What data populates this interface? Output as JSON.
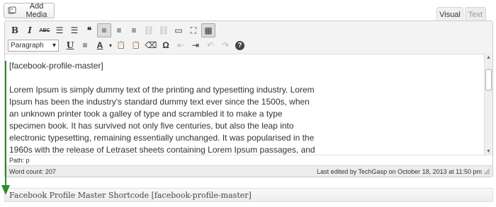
{
  "media": {
    "add_media_label": "Add Media",
    "icon": "media-icon"
  },
  "tabs": {
    "visual": "Visual",
    "text": "Text"
  },
  "toolbar": {
    "row1": [
      {
        "name": "bold-button",
        "glyph": "B"
      },
      {
        "name": "italic-button",
        "glyph": "I"
      },
      {
        "name": "strikethrough-button",
        "glyph": "ABC"
      },
      {
        "name": "bullet-list-button",
        "glyph": "☰"
      },
      {
        "name": "numbered-list-button",
        "glyph": "☰"
      },
      {
        "name": "blockquote-button",
        "glyph": "❝"
      },
      {
        "name": "align-left-button",
        "glyph": "≡"
      },
      {
        "name": "align-center-button",
        "glyph": "≡"
      },
      {
        "name": "align-right-button",
        "glyph": "≡"
      },
      {
        "name": "insert-link-button",
        "glyph": "⛓"
      },
      {
        "name": "remove-link-button",
        "glyph": "⛓"
      },
      {
        "name": "insert-more-button",
        "glyph": "▭"
      },
      {
        "name": "fullscreen-button",
        "glyph": "⛶"
      },
      {
        "name": "kitchen-sink-button",
        "glyph": "▦"
      }
    ],
    "format_select": "Paragraph",
    "row2": [
      {
        "name": "underline-button",
        "glyph": "U"
      },
      {
        "name": "justify-button",
        "glyph": "≡"
      },
      {
        "name": "text-color-button",
        "glyph": "A"
      },
      {
        "name": "paste-text-button",
        "glyph": "📋"
      },
      {
        "name": "paste-word-button",
        "glyph": "📋"
      },
      {
        "name": "clear-formatting-button",
        "glyph": "⌫"
      },
      {
        "name": "special-character-button",
        "glyph": "Ω"
      },
      {
        "name": "outdent-button",
        "glyph": "⇤"
      },
      {
        "name": "indent-button",
        "glyph": "⇥"
      },
      {
        "name": "undo-button",
        "glyph": "↶"
      },
      {
        "name": "redo-button",
        "glyph": "↷"
      },
      {
        "name": "help-button",
        "glyph": "?"
      }
    ]
  },
  "content": {
    "shortcode_line": "[facebook-profile-master]",
    "lorem": "Lorem Ipsum is simply dummy text of the printing and typesetting industry. Lorem Ipsum has been the industry's standard dummy text ever since the 1500s, when an unknown printer took a galley of type and scrambled it to make a type specimen book. It has survived not only five centuries, but also the leap into electronic typesetting, remaining essentially unchanged. It was popularised in the 1960s with the release of Letraset sheets containing Lorem Ipsum passages, and more recently with desktop publishing software"
  },
  "path": "Path: p",
  "status": {
    "word_count": "Word count: 207",
    "last_edited": "Last edited by TechGasp on October 18, 2013 at 11:50 pm"
  },
  "shortcode_box": {
    "label": "Facebook Profile Master Shortcode [facebook-profile-master]"
  },
  "colors": {
    "arrow": "#2e8b2e",
    "active_button": "#dcdcdc"
  }
}
